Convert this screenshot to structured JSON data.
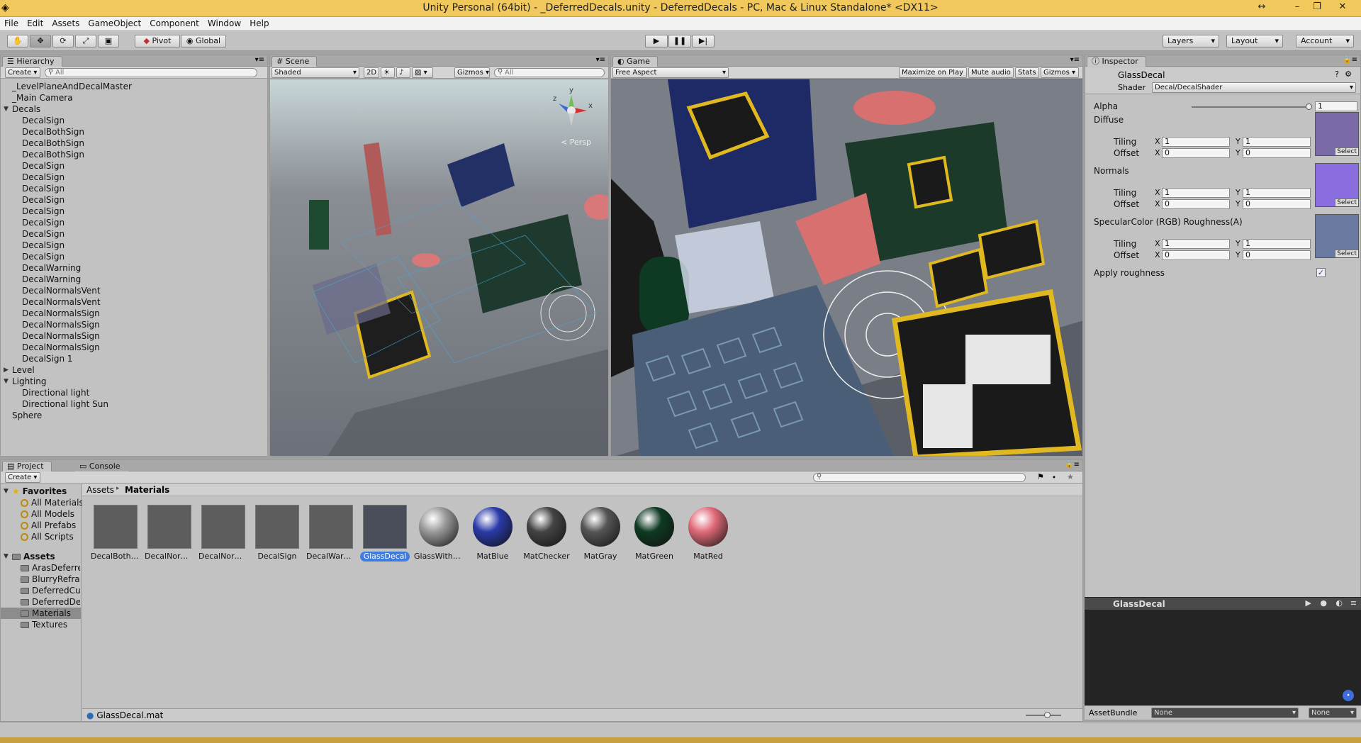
{
  "window": {
    "title": "Unity Personal (64bit) - _DeferredDecals.unity - DeferredDecals - PC, Mac & Linux Standalone* <DX11>"
  },
  "menu": [
    "File",
    "Edit",
    "Assets",
    "GameObject",
    "Component",
    "Window",
    "Help"
  ],
  "toolbar": {
    "pivot": "Pivot",
    "global": "Global",
    "layers": "Layers",
    "layout": "Layout",
    "account": "Account"
  },
  "hierarchy": {
    "tab": "Hierarchy",
    "create": "Create",
    "search_placeholder": "All",
    "items": [
      {
        "label": "_LevelPlaneAndDecalMaster",
        "depth": 0
      },
      {
        "label": "_Main Camera",
        "depth": 0
      },
      {
        "label": "Decals",
        "depth": 0,
        "expanded": true
      },
      {
        "label": "DecalSign",
        "depth": 1
      },
      {
        "label": "DecalBothSign",
        "depth": 1
      },
      {
        "label": "DecalBothSign",
        "depth": 1
      },
      {
        "label": "DecalBothSign",
        "depth": 1
      },
      {
        "label": "DecalSign",
        "depth": 1
      },
      {
        "label": "DecalSign",
        "depth": 1
      },
      {
        "label": "DecalSign",
        "depth": 1
      },
      {
        "label": "DecalSign",
        "depth": 1
      },
      {
        "label": "DecalSign",
        "depth": 1
      },
      {
        "label": "DecalSign",
        "depth": 1
      },
      {
        "label": "DecalSign",
        "depth": 1
      },
      {
        "label": "DecalSign",
        "depth": 1
      },
      {
        "label": "DecalSign",
        "depth": 1
      },
      {
        "label": "DecalWarning",
        "depth": 1
      },
      {
        "label": "DecalWarning",
        "depth": 1
      },
      {
        "label": "DecalNormalsVent",
        "depth": 1
      },
      {
        "label": "DecalNormalsVent",
        "depth": 1
      },
      {
        "label": "DecalNormalsSign",
        "depth": 1
      },
      {
        "label": "DecalNormalsSign",
        "depth": 1
      },
      {
        "label": "DecalNormalsSign",
        "depth": 1
      },
      {
        "label": "DecalNormalsSign",
        "depth": 1
      },
      {
        "label": "DecalSign 1",
        "depth": 1
      },
      {
        "label": "Level",
        "depth": 0,
        "expanded": false
      },
      {
        "label": "Lighting",
        "depth": 0,
        "expanded": true
      },
      {
        "label": "Directional light",
        "depth": 1
      },
      {
        "label": "Directional light Sun",
        "depth": 1
      },
      {
        "label": "Sphere",
        "depth": 0
      }
    ]
  },
  "scene": {
    "tab": "Scene",
    "shading": "Shaded",
    "mode_2d": "2D",
    "gizmos": "Gizmos",
    "search_placeholder": "All",
    "persp": "Persp",
    "axis_y": "y",
    "axis_z": "z",
    "axis_x": "x"
  },
  "game": {
    "tab": "Game",
    "aspect": "Free Aspect",
    "maximize": "Maximize on Play",
    "mute": "Mute audio",
    "stats": "Stats",
    "gizmos": "Gizmos"
  },
  "inspector": {
    "tab": "Inspector",
    "object_name": "GlassDecal",
    "shader_label": "Shader",
    "shader_value": "Decal/DecalShader",
    "alpha_label": "Alpha",
    "alpha_value": "1",
    "alpha_fraction": 1.0,
    "textures": [
      {
        "label": "Diffuse",
        "tiling_x": "1",
        "tiling_y": "1",
        "offset_x": "0",
        "offset_y": "0",
        "color": "#7a6aa8"
      },
      {
        "label": "Normals",
        "tiling_x": "1",
        "tiling_y": "1",
        "offset_x": "0",
        "offset_y": "0",
        "color": "#8a6ee0"
      },
      {
        "label": "SpecularColor (RGB) Roughness(A)",
        "tiling_x": "1",
        "tiling_y": "1",
        "offset_x": "0",
        "offset_y": "0",
        "color": "#6a7aa0"
      }
    ],
    "tiling_label": "Tiling",
    "offset_label": "Offset",
    "x_label": "X",
    "y_label": "Y",
    "select_label": "Select",
    "apply_roughness": "Apply roughness",
    "preview_title": "GlassDecal",
    "assetbundle_label": "AssetBundle",
    "assetbundle_value": "None",
    "assetbundle_variant": "None"
  },
  "project": {
    "tab": "Project",
    "console_tab": "Console",
    "create": "Create",
    "favorites_label": "Favorites",
    "favorites": [
      "All Materials",
      "All Models",
      "All Prefabs",
      "All Scripts"
    ],
    "assets_label": "Assets",
    "folders": [
      "ArasDeferre",
      "BlurryRefra",
      "DeferredCu",
      "DeferredDe",
      "Materials",
      "Textures"
    ],
    "selected_folder": "Materials",
    "breadcrumb": [
      "Assets",
      "Materials"
    ],
    "items": [
      {
        "label": "DecalBothS...",
        "kind": "flat"
      },
      {
        "label": "DecalNorm...",
        "kind": "flat"
      },
      {
        "label": "DecalNorm...",
        "kind": "flat"
      },
      {
        "label": "DecalSign",
        "kind": "flat"
      },
      {
        "label": "DecalWarni...",
        "kind": "flat"
      },
      {
        "label": "GlassDecal",
        "kind": "flat-selected"
      },
      {
        "label": "GlassWitho...",
        "kind": "sphere",
        "color": "#9a9a9a"
      },
      {
        "label": "MatBlue",
        "kind": "sphere",
        "color": "#2a3aa8"
      },
      {
        "label": "MatChecker",
        "kind": "sphere",
        "color": "#444444"
      },
      {
        "label": "MatGray",
        "kind": "sphere",
        "color": "#555555"
      },
      {
        "label": "MatGreen",
        "kind": "sphere",
        "color": "#0e3a22"
      },
      {
        "label": "MatRed",
        "kind": "sphere",
        "color": "#e06a78"
      }
    ],
    "selected_file": "GlassDecal.mat"
  }
}
